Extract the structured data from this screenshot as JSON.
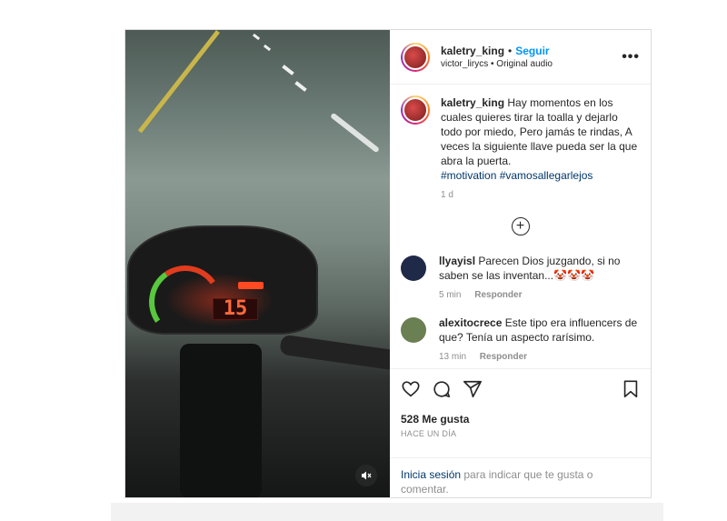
{
  "header": {
    "username": "kaletry_king",
    "separator": "•",
    "follow_label": "Seguir",
    "subtitle": "victor_lirycs • Original audio",
    "more_label": "•••"
  },
  "caption": {
    "username": "kaletry_king",
    "text": "Hay momentos en los cuales quieres tirar la toalla y dejarlo todo por miedo, Pero jamás te rindas, A veces la siguiente llave pueda ser la que abra la puerta.",
    "hashtags": "#motivation #vamosallegarlejos",
    "age": "1 d"
  },
  "load_more_label": "+",
  "comments": [
    {
      "username": "llyayisl",
      "text": "Parecen Dios juzgando, si no saben se las inventan...🤡🤡🤡",
      "age": "5 min",
      "reply_label": "Responder",
      "avatar_color": "#1f2a48"
    },
    {
      "username": "alexitocrece",
      "text": "Este tipo era influencers de que? Tenía un aspecto rarísimo.",
      "age": "13 min",
      "reply_label": "Responder",
      "avatar_color": "#6a7f52"
    }
  ],
  "actions": {
    "likes": "528 Me gusta",
    "posted": "HACE UN DÍA"
  },
  "login": {
    "link": "Inicia sesión",
    "text": " para indicar que te gusta o comentar."
  },
  "media": {
    "speedometer_reading": "15",
    "icons": [
      "mute-icon"
    ]
  },
  "colors": {
    "accent": "#0095f6",
    "hashtag": "#00376b",
    "muted": "#8e8e8e"
  }
}
